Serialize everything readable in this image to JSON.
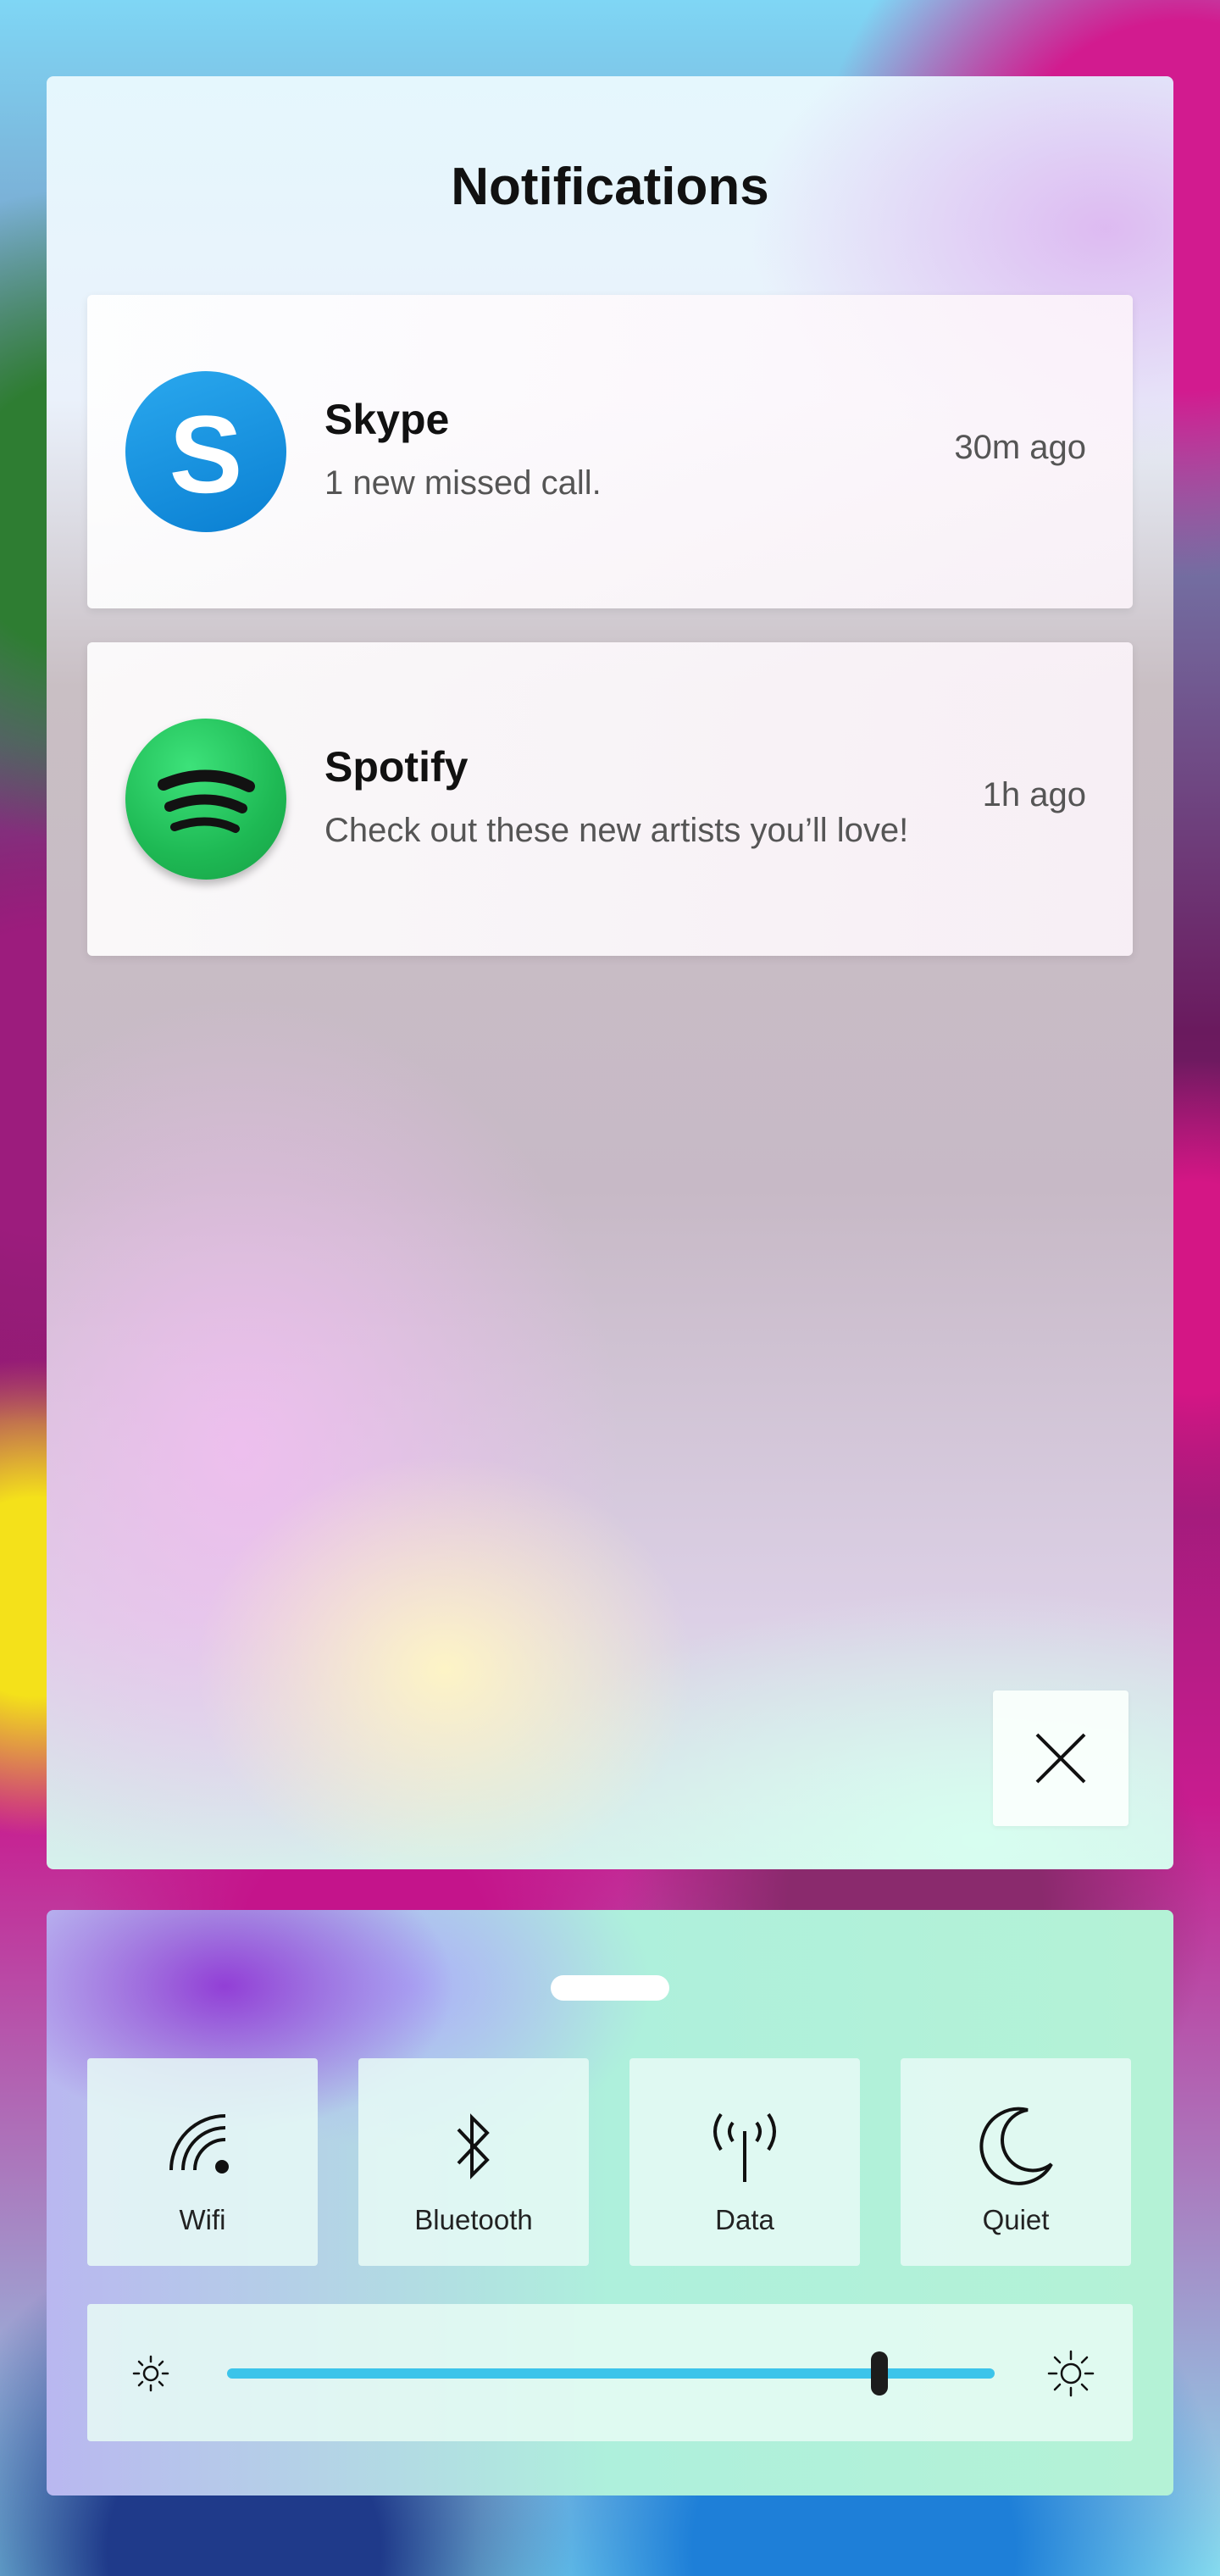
{
  "panel": {
    "title": "Notifications"
  },
  "notifications": [
    {
      "app": "Skype",
      "message": "1 new missed call.",
      "time": "30m ago",
      "icon": "skype-icon",
      "icon_letter": "S",
      "accent": "#0a7fd2"
    },
    {
      "app": "Spotify",
      "message": "Check out these new artists you’ll love!",
      "time": "1h ago",
      "icon": "spotify-icon",
      "accent": "#1eb954"
    }
  ],
  "close": {
    "icon": "close-icon"
  },
  "quick_settings": {
    "tiles": [
      {
        "label": "Wifi",
        "icon": "wifi-icon"
      },
      {
        "label": "Bluetooth",
        "icon": "bluetooth-icon"
      },
      {
        "label": "Data",
        "icon": "antenna-icon"
      },
      {
        "label": "Quiet",
        "icon": "moon-icon"
      }
    ],
    "brightness": {
      "level": 0.85,
      "track_color": "#3cc4ea",
      "min_icon": "brightness-low-icon",
      "max_icon": "brightness-high-icon"
    }
  }
}
